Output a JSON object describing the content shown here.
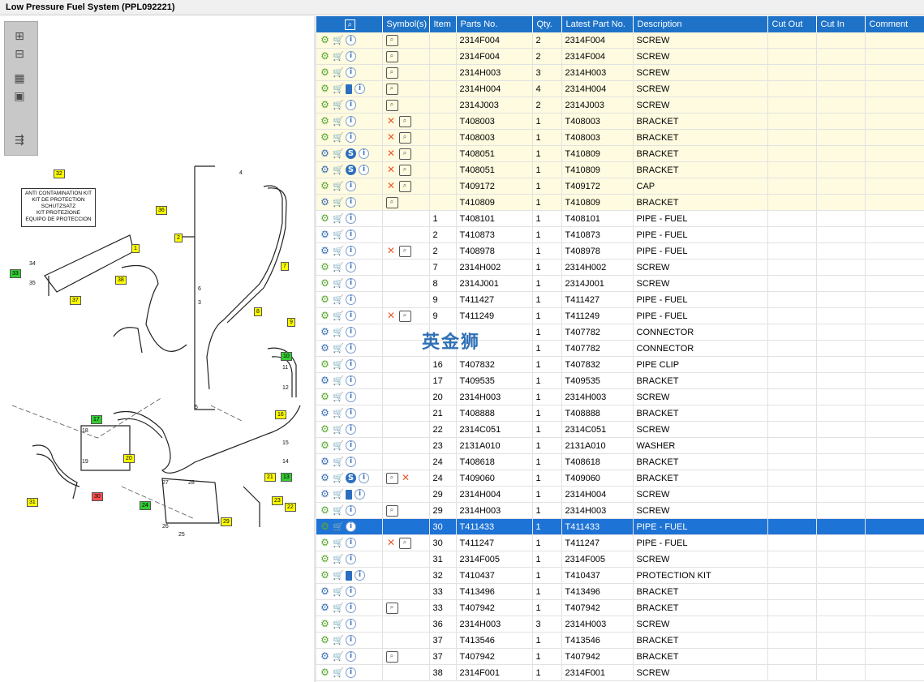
{
  "window": {
    "title": "Low Pressure Fuel System (PPL092221)"
  },
  "watermark": "英金狮",
  "diagram": {
    "kit_text": [
      "ANTI CONTAMINATION KIT",
      "KIT DE PROTECTION",
      "SCHUTZSATZ",
      "KIT PROTEZIONE",
      "EQUIPO DE PROTECCION"
    ],
    "callouts_yellow": [
      "32",
      "36",
      "2",
      "4",
      "7",
      "38",
      "8",
      "9",
      "37",
      "16",
      "20",
      "21",
      "23",
      "22",
      "29",
      "31",
      "1"
    ],
    "callouts_green": [
      "33",
      "10",
      "17",
      "13",
      "24"
    ],
    "callouts_red": [
      "30"
    ],
    "labels": [
      "34",
      "35",
      "6",
      "3",
      "5",
      "11",
      "12",
      "15",
      "14",
      "18",
      "19",
      "27",
      "28",
      "26",
      "25"
    ]
  },
  "table": {
    "headers": [
      "Symbol(s)",
      "Item",
      "Parts No.",
      "Qty.",
      "Latest Part No.",
      "Description",
      "Cut Out",
      "Cut In",
      "Comment"
    ],
    "rows": [
      {
        "icons": "gci",
        "sym": "m",
        "item": "",
        "part": "2314F004",
        "qty": "2",
        "latest": "2314F004",
        "desc": "SCREW",
        "hl": true
      },
      {
        "icons": "gci",
        "sym": "m",
        "item": "",
        "part": "2314F004",
        "qty": "2",
        "latest": "2314F004",
        "desc": "SCREW",
        "hl": true
      },
      {
        "icons": "gci",
        "sym": "m",
        "item": "",
        "part": "2314H003",
        "qty": "3",
        "latest": "2314H003",
        "desc": "SCREW",
        "hl": true
      },
      {
        "icons": "gcbi",
        "sym": "m",
        "item": "",
        "part": "2314H004",
        "qty": "4",
        "latest": "2314H004",
        "desc": "SCREW",
        "hl": true
      },
      {
        "icons": "gci",
        "sym": "m",
        "item": "",
        "part": "2314J003",
        "qty": "2",
        "latest": "2314J003",
        "desc": "SCREW",
        "hl": true
      },
      {
        "icons": "gci",
        "sym": "xm",
        "item": "",
        "part": "T408003",
        "qty": "1",
        "latest": "T408003",
        "desc": "BRACKET",
        "hl": true
      },
      {
        "icons": "gci",
        "sym": "xm",
        "item": "",
        "part": "T408003",
        "qty": "1",
        "latest": "T408003",
        "desc": "BRACKET",
        "hl": true
      },
      {
        "icons": "Gcsi",
        "sym": "xm",
        "item": "",
        "part": "T408051",
        "qty": "1",
        "latest": "T410809",
        "desc": "BRACKET",
        "hl": true
      },
      {
        "icons": "Gcsi",
        "sym": "xm",
        "item": "",
        "part": "T408051",
        "qty": "1",
        "latest": "T410809",
        "desc": "BRACKET",
        "hl": true
      },
      {
        "icons": "gci",
        "sym": "xm",
        "item": "",
        "part": "T409172",
        "qty": "1",
        "latest": "T409172",
        "desc": "CAP",
        "hl": true
      },
      {
        "icons": "Gci",
        "sym": "m",
        "item": "",
        "part": "T410809",
        "qty": "1",
        "latest": "T410809",
        "desc": "BRACKET",
        "hl": true
      },
      {
        "icons": "gci",
        "sym": "",
        "item": "1",
        "part": "T408101",
        "qty": "1",
        "latest": "T408101",
        "desc": "PIPE - FUEL"
      },
      {
        "icons": "Gci",
        "sym": "",
        "item": "2",
        "part": "T410873",
        "qty": "1",
        "latest": "T410873",
        "desc": "PIPE - FUEL"
      },
      {
        "icons": "Gci",
        "sym": "xm",
        "item": "2",
        "part": "T408978",
        "qty": "1",
        "latest": "T408978",
        "desc": "PIPE - FUEL"
      },
      {
        "icons": "gci",
        "sym": "",
        "item": "7",
        "part": "2314H002",
        "qty": "1",
        "latest": "2314H002",
        "desc": "SCREW"
      },
      {
        "icons": "gci",
        "sym": "",
        "item": "8",
        "part": "2314J001",
        "qty": "1",
        "latest": "2314J001",
        "desc": "SCREW"
      },
      {
        "icons": "gci",
        "sym": "",
        "item": "9",
        "part": "T411427",
        "qty": "1",
        "latest": "T411427",
        "desc": "PIPE - FUEL"
      },
      {
        "icons": "gci",
        "sym": "xm",
        "item": "9",
        "part": "T411249",
        "qty": "1",
        "latest": "T411249",
        "desc": "PIPE - FUEL"
      },
      {
        "icons": "Gci",
        "sym": "",
        "item": "",
        "part": "",
        "qty": "1",
        "latest": "T407782",
        "desc": "CONNECTOR"
      },
      {
        "icons": "Gci",
        "sym": "",
        "item": "",
        "part": "",
        "qty": "1",
        "latest": "T407782",
        "desc": "CONNECTOR"
      },
      {
        "icons": "gci",
        "sym": "",
        "item": "16",
        "part": "T407832",
        "qty": "1",
        "latest": "T407832",
        "desc": "PIPE CLIP"
      },
      {
        "icons": "Gci",
        "sym": "",
        "item": "17",
        "part": "T409535",
        "qty": "1",
        "latest": "T409535",
        "desc": "BRACKET"
      },
      {
        "icons": "gci",
        "sym": "",
        "item": "20",
        "part": "2314H003",
        "qty": "1",
        "latest": "2314H003",
        "desc": "SCREW"
      },
      {
        "icons": "Gci",
        "sym": "",
        "item": "21",
        "part": "T408888",
        "qty": "1",
        "latest": "T408888",
        "desc": "BRACKET"
      },
      {
        "icons": "gci",
        "sym": "",
        "item": "22",
        "part": "2314C051",
        "qty": "1",
        "latest": "2314C051",
        "desc": "SCREW"
      },
      {
        "icons": "gci",
        "sym": "",
        "item": "23",
        "part": "2131A010",
        "qty": "1",
        "latest": "2131A010",
        "desc": "WASHER"
      },
      {
        "icons": "Gci",
        "sym": "",
        "item": "24",
        "part": "T408618",
        "qty": "1",
        "latest": "T408618",
        "desc": "BRACKET"
      },
      {
        "icons": "Gcsi",
        "sym": "mx",
        "item": "24",
        "part": "T409060",
        "qty": "1",
        "latest": "T409060",
        "desc": "BRACKET"
      },
      {
        "icons": "Gcbi",
        "sym": "",
        "item": "29",
        "part": "2314H004",
        "qty": "1",
        "latest": "2314H004",
        "desc": "SCREW"
      },
      {
        "icons": "gci",
        "sym": "m",
        "item": "29",
        "part": "2314H003",
        "qty": "1",
        "latest": "2314H003",
        "desc": "SCREW"
      },
      {
        "icons": "gci",
        "sym": "",
        "item": "30",
        "part": "T411433",
        "qty": "1",
        "latest": "T411433",
        "desc": "PIPE - FUEL",
        "sel": true
      },
      {
        "icons": "gci",
        "sym": "xm",
        "item": "30",
        "part": "T411247",
        "qty": "1",
        "latest": "T411247",
        "desc": "PIPE - FUEL"
      },
      {
        "icons": "gci",
        "sym": "",
        "item": "31",
        "part": "2314F005",
        "qty": "1",
        "latest": "2314F005",
        "desc": "SCREW"
      },
      {
        "icons": "gcbi",
        "sym": "",
        "item": "32",
        "part": "T410437",
        "qty": "1",
        "latest": "T410437",
        "desc": "PROTECTION KIT"
      },
      {
        "icons": "Gci",
        "sym": "",
        "item": "33",
        "part": "T413496",
        "qty": "1",
        "latest": "T413496",
        "desc": "BRACKET"
      },
      {
        "icons": "Gci",
        "sym": "m",
        "item": "33",
        "part": "T407942",
        "qty": "1",
        "latest": "T407942",
        "desc": "BRACKET"
      },
      {
        "icons": "gci",
        "sym": "",
        "item": "36",
        "part": "2314H003",
        "qty": "3",
        "latest": "2314H003",
        "desc": "SCREW"
      },
      {
        "icons": "gci",
        "sym": "",
        "item": "37",
        "part": "T413546",
        "qty": "1",
        "latest": "T413546",
        "desc": "BRACKET"
      },
      {
        "icons": "Gci",
        "sym": "m",
        "item": "37",
        "part": "T407942",
        "qty": "1",
        "latest": "T407942",
        "desc": "BRACKET"
      },
      {
        "icons": "gci",
        "sym": "",
        "item": "38",
        "part": "2314F001",
        "qty": "1",
        "latest": "2314F001",
        "desc": "SCREW"
      }
    ]
  }
}
